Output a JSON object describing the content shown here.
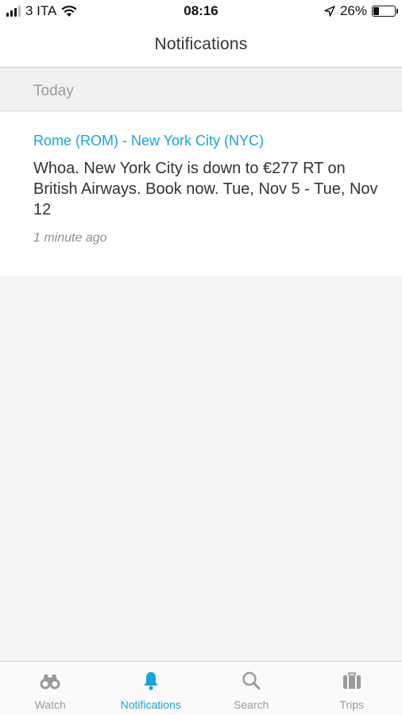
{
  "status_bar": {
    "carrier": "3 ITA",
    "time": "08:16",
    "battery_percent": "26%",
    "battery_level": 0.26
  },
  "header": {
    "title": "Notifications"
  },
  "sections": [
    {
      "label": "Today",
      "notifications": [
        {
          "route": "Rome (ROM) - New York City (NYC)",
          "message": "Whoa. New York City is down to €277 RT on British Airways. Book now. Tue, Nov 5 - Tue, Nov 12",
          "time_ago": "1 minute ago"
        }
      ]
    }
  ],
  "tab_bar": {
    "active": "notifications",
    "tabs": [
      {
        "id": "watch",
        "label": "Watch",
        "icon": "binoculars-icon"
      },
      {
        "id": "notifications",
        "label": "Notifications",
        "icon": "bell-icon"
      },
      {
        "id": "search",
        "label": "Search",
        "icon": "search-icon"
      },
      {
        "id": "trips",
        "label": "Trips",
        "icon": "suitcase-icon"
      }
    ]
  },
  "colors": {
    "accent": "#1aa3d8",
    "inactive": "#9a9a9a"
  }
}
